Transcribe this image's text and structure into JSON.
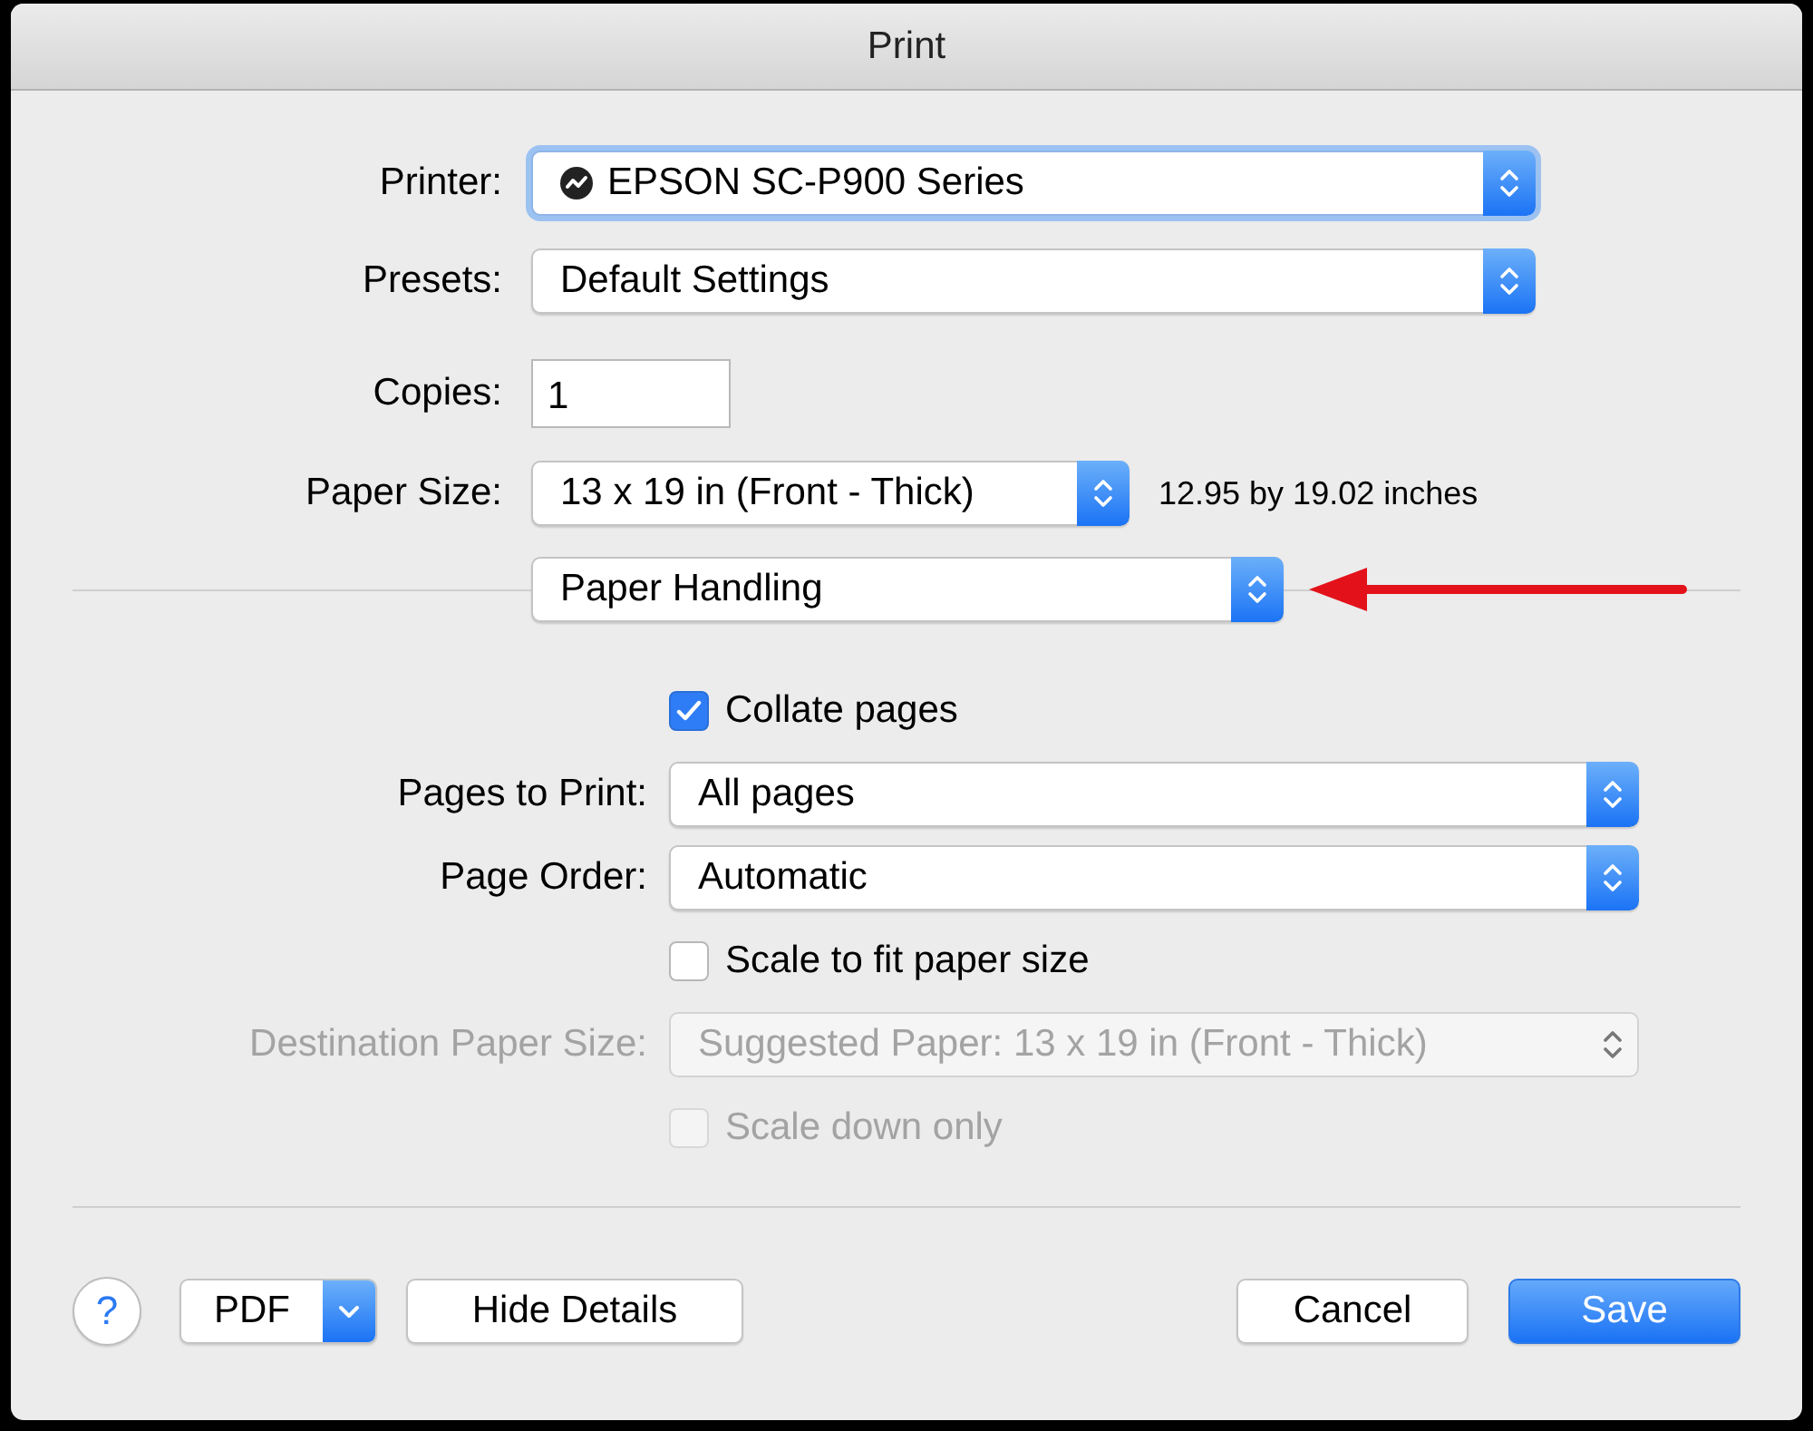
{
  "window": {
    "title": "Print"
  },
  "upper_rows": [
    {
      "kind": "popup",
      "label": "Printer:",
      "value": "EPSON SC-P900 Series",
      "status_icon": true,
      "focused": true
    },
    {
      "kind": "popup",
      "label": "Presets:",
      "value": "Default Settings",
      "status_icon": false,
      "focused": false
    },
    {
      "kind": "field",
      "label": "Copies:",
      "value": "1"
    },
    {
      "kind": "popup",
      "label": "Paper Size:",
      "value": "13 x 19 in (Front - Thick)",
      "status_icon": false,
      "focused": false,
      "note": "12.95 by 19.02 inches"
    }
  ],
  "panel_selector": {
    "value": "Paper Handling"
  },
  "lower_rows": [
    {
      "kind": "checkbox",
      "label": "Collate pages",
      "checked": true,
      "disabled": false
    },
    {
      "kind": "popup",
      "label": "Pages to Print:",
      "value": "All pages",
      "disabled": false
    },
    {
      "kind": "popup",
      "label": "Page Order:",
      "value": "Automatic",
      "disabled": false
    },
    {
      "kind": "checkbox",
      "label": "Scale to fit paper size",
      "checked": false,
      "disabled": false
    },
    {
      "kind": "popup",
      "label": "Destination Paper Size:",
      "value": "Suggested Paper: 13 x 19 in (Front - Thick)",
      "disabled": true
    },
    {
      "kind": "checkbox",
      "label": "Scale down only",
      "checked": false,
      "disabled": true
    }
  ],
  "footer": {
    "help": "?",
    "pdf": "PDF",
    "left_buttons": [
      {
        "label": "Hide Details",
        "default": false
      }
    ],
    "right_buttons": [
      {
        "label": "Cancel",
        "default": false
      },
      {
        "label": "Save",
        "default": true
      }
    ]
  }
}
